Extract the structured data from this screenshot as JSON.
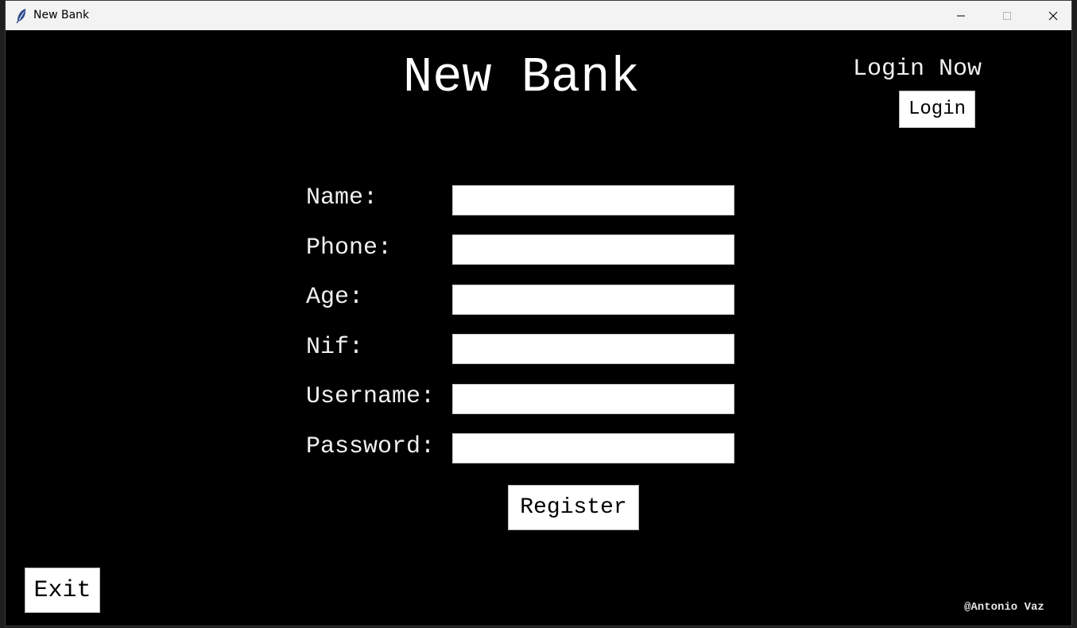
{
  "window": {
    "title": "New Bank",
    "app_icon": "feather-icon",
    "controls": [
      "minimize-icon",
      "maximize-icon",
      "close-icon"
    ]
  },
  "colors": {
    "background": "#000000",
    "text": "#ffffff",
    "button_bg": "#ffffff",
    "button_text": "#000000",
    "titlebar": "#f3f3f3"
  },
  "header": {
    "app_title": "New Bank",
    "login_prompt": "Login Now",
    "login_button": "Login"
  },
  "form": {
    "fields": [
      {
        "label": "Name:",
        "value": ""
      },
      {
        "label": "Phone:",
        "value": ""
      },
      {
        "label": "Age:",
        "value": ""
      },
      {
        "label": "Nif:",
        "value": ""
      },
      {
        "label": "Username:",
        "value": ""
      },
      {
        "label": "Password:",
        "value": ""
      }
    ],
    "register_button": "Register"
  },
  "footer": {
    "exit_button": "Exit",
    "credit": "@Antonio Vaz"
  }
}
